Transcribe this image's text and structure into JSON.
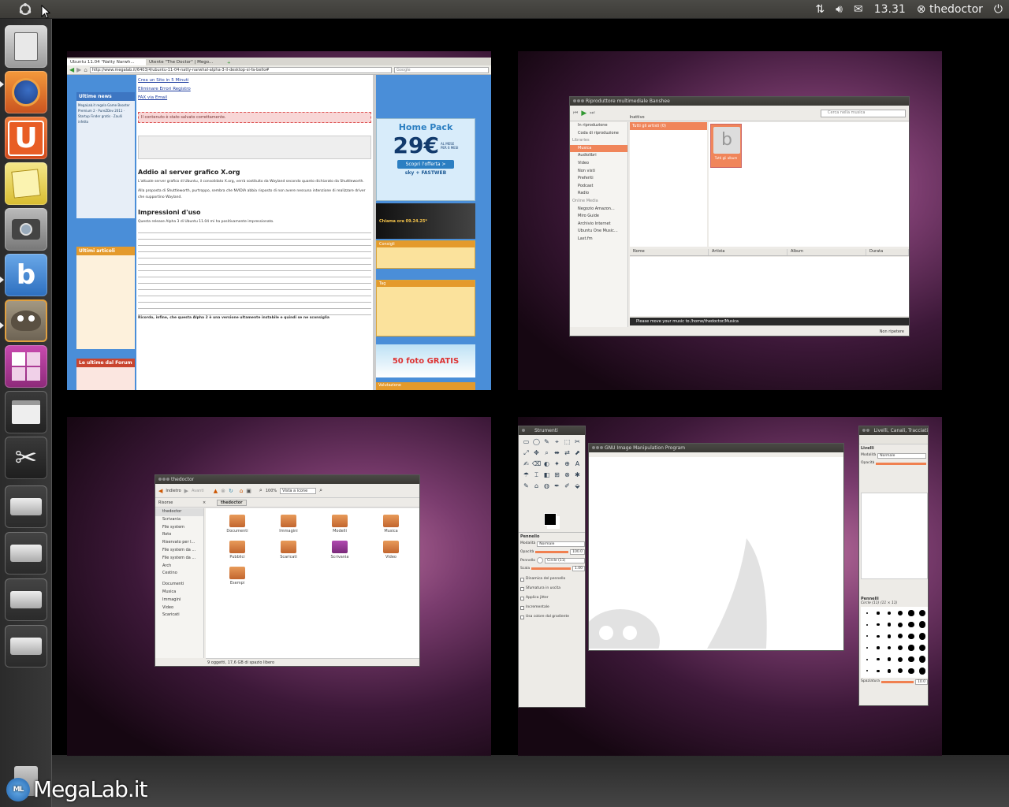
{
  "panel": {
    "clock": "13.31",
    "user": "thedoctor"
  },
  "launcher": {
    "items": [
      "files-home",
      "firefox",
      "ubuntu-one",
      "text-editor",
      "shotwell",
      "banshee",
      "gimp",
      "workspaces",
      "file-manager",
      "screenshot",
      "drive-1",
      "drive-2",
      "drive-3",
      "drive-4",
      "trash"
    ]
  },
  "browser": {
    "tab1": "Ubuntu 11.04 \"Natty Narwh...",
    "tab2": "Utente \"The Doctor\" | Mego...",
    "url": "http://www.megalab.it/6403/4/ubuntu-11-04-natty-narwhal-alpha-3-il-desktop-si-fa-bello#",
    "search": "Google",
    "ad1": "Crea un Sito in 5 Minuti",
    "ad2": "Eliminare Errori Registro",
    "ad3": "FAX via Email",
    "saved": "Il contenuto è stato salvato correttamente.",
    "h1": "Addio al server grafico X.org",
    "h2": "Impressioni d'uso",
    "p1": "L'attuale server grafico di Ubuntu, il consolidato X.org, verrà sostituito da Wayland secondo quanto dichiarato da Shuttleworth.",
    "p2": "Alla proposta di Shuttleworth, purtroppo, sembra che NVIDIA abbia risposto di non avere nessuna intenzione di realizzare driver che supportino Wayland.",
    "p3": "Questa release Alpha 3 di Ubuntu 11.04 mi ha positivamente impressionato.",
    "p4": "Ricordo, infine, che questa Alpha 2 è una versione ultamente instabile e quindi se ne sconsiglia",
    "side1": "Ultime news",
    "side2": "Ultimi articoli",
    "side3": "Le ultime dal Forum",
    "promo_title": "Home Pack",
    "promo_price": "29€",
    "promo_per": "AL MESE",
    "promo_months": "PER 6 MESI",
    "promo_cta": "Scopri l'offerta >",
    "promo_brand": "sky + FASTWEB",
    "call": "Chiama ora 09.24.25*",
    "box1": "Consigli",
    "box2": "Tag",
    "box3": "Valutazione",
    "photo": "50 foto GRATIS"
  },
  "banshee": {
    "title": "Riproduttore multimediale Banshee",
    "search": "Cerca nella musica",
    "stopped": "Inattivo",
    "sources": [
      "In riproduzione",
      "Coda di riproduzione",
      "Libraries",
      "Musica",
      "Audiolibri",
      "Video",
      "Non visti",
      "Preferiti",
      "Podcast",
      "Radio",
      "Online Media",
      "Negozio Amazon...",
      "Miro Guide",
      "Archivio Internet",
      "Ubuntu One Music...",
      "Last.fm"
    ],
    "artists": "Tutti gli artisti (0)",
    "album": "Tutti gli album",
    "cols": [
      "Nome",
      "Artista",
      "Album",
      "Durata"
    ],
    "status": "Please move your music to /home/thedoctor/Musica",
    "repeat": "Non ripetere"
  },
  "nautilus": {
    "title": "thedoctor",
    "back": "Indietro",
    "forward": "Avanti",
    "zoom": "100%",
    "view": "Vista a icone",
    "sidebar_label": "Risorse",
    "crumb": "thedoctor",
    "places": [
      "thedoctor",
      "Scrivania",
      "File system",
      "Roto",
      "Riservato per l...",
      "File system da ...",
      "File system da ...",
      "Arch",
      "Cestino",
      "Documenti",
      "Musica",
      "Immagini",
      "Video",
      "Scaricati"
    ],
    "icons": [
      "Documenti",
      "Immagini",
      "Modelli",
      "Musica",
      "Pubblici",
      "Scaricati",
      "Scrivania",
      "Video",
      "Esempi"
    ],
    "status": "9 oggetti, 17,6 GB di spazio libero"
  },
  "gimp": {
    "toolbox": "Strumenti",
    "canvas": "GNU Image Manipulation Program",
    "layers": "Livelli, Canali, Tracciati",
    "brush": "Pennello",
    "mode_lbl": "Modalità",
    "mode": "Normale",
    "opacity_lbl": "Opacità",
    "opacity": "100.0",
    "brush_name": "Circle (11)",
    "scale_lbl": "Scala",
    "scale": "1.00",
    "opts": [
      "Dinamica del pennello",
      "Sfumatura in uscita",
      "Applica jitter",
      "Incrementale",
      "Usa colore dal gradiente"
    ],
    "layers_lbl": "Livelli",
    "brushes_lbl": "Pennelli",
    "brush_sel": "Circle (11) (11 × 11)",
    "spacing_lbl": "Spaziatura",
    "spacing": "10.0"
  },
  "watermark": "MegaLab.it"
}
